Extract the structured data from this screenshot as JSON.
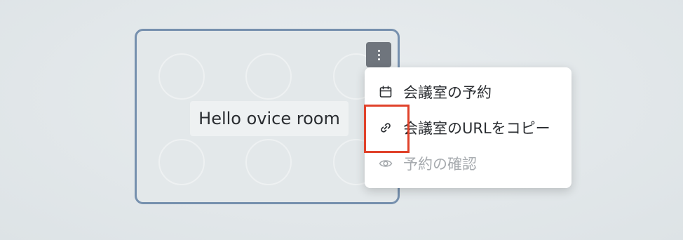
{
  "room": {
    "name": "Hello ovice room"
  },
  "menu": {
    "items": [
      {
        "label": "会議室の予約",
        "icon": "calendar-icon",
        "disabled": false
      },
      {
        "label": "会議室のURLをコピー",
        "icon": "link-icon",
        "disabled": false
      },
      {
        "label": "予約の確認",
        "icon": "eye-icon",
        "disabled": true
      }
    ]
  },
  "colors": {
    "card_border": "#7690ae",
    "kebab_bg": "#6f757d",
    "highlight": "#e0422a",
    "text": "#2a2d31",
    "disabled_text": "#a7abaf"
  }
}
